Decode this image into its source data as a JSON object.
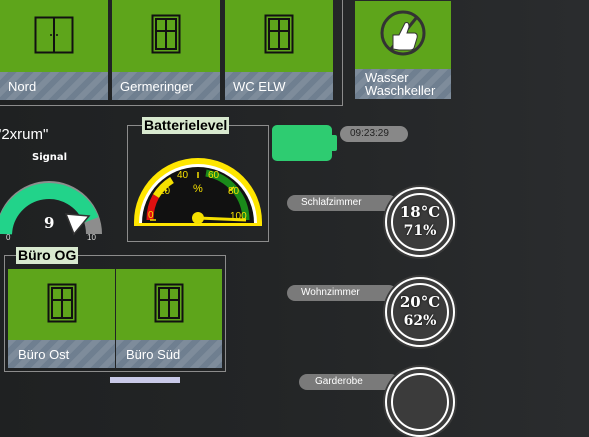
{
  "top_tiles": [
    {
      "label": "Nord",
      "icon": "window-icon"
    },
    {
      "label": "Germeringer",
      "icon": "window-icon"
    },
    {
      "label": "WC ELW",
      "icon": "window-icon"
    }
  ],
  "wasser_tile": {
    "label_line1": "Wasser",
    "label_line2": "Waschkeller",
    "icon": "thumbs-up-icon"
  },
  "room_name": "\"2xrum\"",
  "signal": {
    "title": "Signal",
    "value": "9",
    "min": "0",
    "max": "10",
    "level": 0.9
  },
  "battery": {
    "title": "Batterielevel",
    "unit": "%",
    "ticks": [
      "0",
      "20",
      "40",
      "60",
      "80",
      "100"
    ],
    "value_percent": 100,
    "status_color": "#2ecc71"
  },
  "time_badge": "09:23:29",
  "climate": [
    {
      "room": "Schlafzimmer",
      "temp": "18°C",
      "humidity": "71%"
    },
    {
      "room": "Wohnzimmer",
      "temp": "20°C",
      "humidity": "62%"
    },
    {
      "room": "Garderobe",
      "temp": "",
      "humidity": ""
    }
  ],
  "buero_og": {
    "title": "Büro OG",
    "tiles": [
      {
        "label": "Büro Ost",
        "icon": "window-icon"
      },
      {
        "label": "Büro Süd",
        "icon": "window-icon"
      }
    ]
  },
  "colors": {
    "tile_green": "#5ea51b",
    "label_bar": "#6f7f90",
    "gauge_yellow": "#ffe600"
  }
}
